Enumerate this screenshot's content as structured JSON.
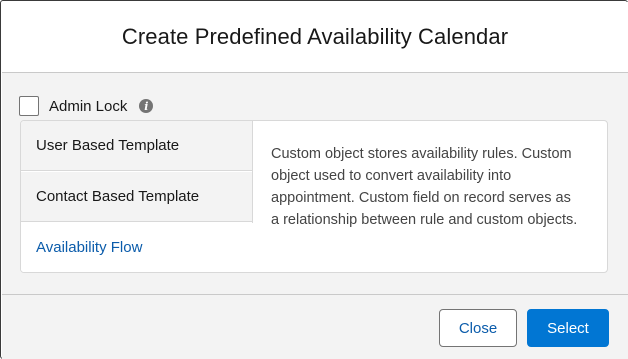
{
  "modal": {
    "title": "Create Predefined Availability Calendar"
  },
  "admin_lock": {
    "label": "Admin Lock",
    "checked": false,
    "info_icon": "info-icon"
  },
  "templates": {
    "items": [
      {
        "label": "User Based Template",
        "selected": false
      },
      {
        "label": "Contact Based Template",
        "selected": false
      },
      {
        "label": "Availability Flow",
        "selected": true
      }
    ],
    "description": "Custom object stores availability rules. Custom object used to convert availability into appointment. Custom field on record serves as a relationship between rule and custom objects."
  },
  "footer": {
    "close_label": "Close",
    "select_label": "Select"
  },
  "colors": {
    "brand": "#0176d3",
    "link": "#0b5cab",
    "panel_bg": "#f3f3f3"
  }
}
